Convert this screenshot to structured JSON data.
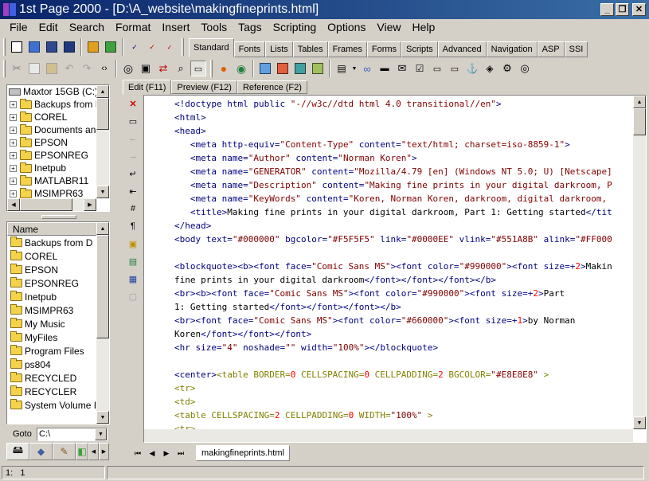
{
  "window": {
    "title": "1st Page 2000 - [D:\\A_website\\makingfineprints.html]",
    "controls": {
      "minimize": "_",
      "restore": "❐",
      "close": "✕"
    }
  },
  "menu": [
    "File",
    "Edit",
    "Search",
    "Format",
    "Insert",
    "Tools",
    "Tags",
    "Scripting",
    "Options",
    "View",
    "Help"
  ],
  "tag_tabs": [
    "Standard",
    "Fonts",
    "Lists",
    "Tables",
    "Frames",
    "Forms",
    "Scripts",
    "Advanced",
    "Navigation",
    "ASP",
    "SSI"
  ],
  "active_tag_tab": "Standard",
  "toolbar_icons": [
    "new-file-icon",
    "open-icon",
    "save-icon",
    "save-all-icon",
    "preview-icon",
    "publish-icon",
    "spell-check-icon",
    "spell-check-2-icon",
    "spell-abc-icon"
  ],
  "drives": {
    "header": "Maxtor 15GB (C:)",
    "folders": [
      "Backups from D",
      "COREL",
      "Documents and",
      "EPSON",
      "EPSONREG",
      "Inetpub",
      "MATLABR11",
      "MSIMPR63"
    ]
  },
  "files": {
    "column": "Name",
    "items": [
      "Backups from D",
      "COREL",
      "EPSON",
      "EPSONREG",
      "Inetpub",
      "MSIMPR63",
      "My Music",
      "MyFiles",
      "Program Files",
      "ps804",
      "RECYCLED",
      "RECYCLER",
      "System Volume Info"
    ]
  },
  "goto": {
    "label": "Goto",
    "value": "C:\\"
  },
  "editor_tabs": [
    "Edit (F11)",
    "Preview (F12)",
    "Reference (F2)"
  ],
  "active_editor_tab": "Edit (F11)",
  "document_tab": "makingfineprints.html",
  "status": {
    "position": "1:   1"
  },
  "colors": {
    "tag": "#000080",
    "value": "#800000",
    "other_tag": "#808000",
    "number": "#ff0000",
    "titlebar_start": "#0a246a",
    "titlebar_end": "#3a6ea5"
  },
  "code": [
    [
      [
        "t",
        "<!doctype html public "
      ],
      [
        "v",
        "\"-//w3c//dtd html 4.0 transitional//en\""
      ],
      [
        "t",
        ">"
      ]
    ],
    [
      [
        "t",
        "<html>"
      ]
    ],
    [
      [
        "t",
        "<head>"
      ]
    ],
    [
      [
        "p",
        "   "
      ],
      [
        "t",
        "<meta http-equiv="
      ],
      [
        "v",
        "\"Content-Type\""
      ],
      [
        "t",
        " content="
      ],
      [
        "v",
        "\"text/html; charset=iso-8859-1\""
      ],
      [
        "t",
        ">"
      ]
    ],
    [
      [
        "p",
        "   "
      ],
      [
        "t",
        "<meta name="
      ],
      [
        "v",
        "\"Author\""
      ],
      [
        "t",
        " content="
      ],
      [
        "v",
        "\"Norman Koren\""
      ],
      [
        "t",
        ">"
      ]
    ],
    [
      [
        "p",
        "   "
      ],
      [
        "t",
        "<meta name="
      ],
      [
        "v",
        "\"GENERATOR\""
      ],
      [
        "t",
        " content="
      ],
      [
        "v",
        "\"Mozilla/4.79 [en] (Windows NT 5.0; U) [Netscape]"
      ]
    ],
    [
      [
        "p",
        "   "
      ],
      [
        "t",
        "<meta name="
      ],
      [
        "v",
        "\"Description\""
      ],
      [
        "t",
        " content="
      ],
      [
        "v",
        "\"Making fine prints in your digital darkroom, P"
      ]
    ],
    [
      [
        "p",
        "   "
      ],
      [
        "t",
        "<meta name="
      ],
      [
        "v",
        "\"KeyWords\""
      ],
      [
        "t",
        " content="
      ],
      [
        "v",
        "\"Koren, Norman Koren, darkroom, digital darkroom,"
      ]
    ],
    [
      [
        "p",
        "   "
      ],
      [
        "t",
        "<title>"
      ],
      [
        "p",
        "Making fine prints in your digital darkroom, Part 1: Getting started"
      ],
      [
        "t",
        "</tit"
      ]
    ],
    [
      [
        "t",
        "</head>"
      ]
    ],
    [
      [
        "t",
        "<body text="
      ],
      [
        "v",
        "\"#000000\""
      ],
      [
        "t",
        " bgcolor="
      ],
      [
        "v",
        "\"#F5F5F5\""
      ],
      [
        "t",
        " link="
      ],
      [
        "v",
        "\"#0000EE\""
      ],
      [
        "t",
        " vlink="
      ],
      [
        "v",
        "\"#551A8B\""
      ],
      [
        "t",
        " alink="
      ],
      [
        "v",
        "\"#FF000"
      ]
    ],
    [
      [
        "p",
        ""
      ]
    ],
    [
      [
        "t",
        "<blockquote><b><font face="
      ],
      [
        "v",
        "\"Comic Sans MS\""
      ],
      [
        "t",
        "><font color="
      ],
      [
        "v",
        "\"#990000\""
      ],
      [
        "t",
        "><font size=+"
      ],
      [
        "n",
        "2"
      ],
      [
        "t",
        ">"
      ],
      [
        "p",
        "Makin"
      ]
    ],
    [
      [
        "p",
        "fine prints in your digital darkroom"
      ],
      [
        "t",
        "</font></font></font></b>"
      ]
    ],
    [
      [
        "t",
        "<br><b><font face="
      ],
      [
        "v",
        "\"Comic Sans MS\""
      ],
      [
        "t",
        "><font color="
      ],
      [
        "v",
        "\"#990000\""
      ],
      [
        "t",
        "><font size=+"
      ],
      [
        "n",
        "2"
      ],
      [
        "t",
        ">"
      ],
      [
        "p",
        "Part"
      ]
    ],
    [
      [
        "p",
        "1: Getting started"
      ],
      [
        "t",
        "</font></font></font></b>"
      ]
    ],
    [
      [
        "t",
        "<br><font face="
      ],
      [
        "v",
        "\"Comic Sans MS\""
      ],
      [
        "t",
        "><font color="
      ],
      [
        "v",
        "\"#660000\""
      ],
      [
        "t",
        "><font size=+"
      ],
      [
        "n",
        "1"
      ],
      [
        "t",
        ">"
      ],
      [
        "p",
        "by Norman"
      ]
    ],
    [
      [
        "p",
        "Koren"
      ],
      [
        "t",
        "</font></font></font>"
      ]
    ],
    [
      [
        "t",
        "<hr size="
      ],
      [
        "v",
        "\"4\""
      ],
      [
        "t",
        " noshade="
      ],
      [
        "v",
        "\"\""
      ],
      [
        "t",
        " width="
      ],
      [
        "v",
        "\"100%\""
      ],
      [
        "t",
        "></blockquote>"
      ]
    ],
    [
      [
        "p",
        ""
      ]
    ],
    [
      [
        "t",
        "<center>"
      ],
      [
        "o",
        "<table BORDER="
      ],
      [
        "n",
        "0"
      ],
      [
        "o",
        " CELLSPACING="
      ],
      [
        "n",
        "0"
      ],
      [
        "o",
        " CELLPADDING="
      ],
      [
        "n",
        "2"
      ],
      [
        "o",
        " BGCOLOR="
      ],
      [
        "v",
        "\"#E8E8E8\""
      ],
      [
        "o",
        " >"
      ]
    ],
    [
      [
        "o",
        "<tr>"
      ]
    ],
    [
      [
        "o",
        "<td>"
      ]
    ],
    [
      [
        "o",
        "<table CELLSPACING="
      ],
      [
        "n",
        "2"
      ],
      [
        "o",
        " CELLPADDING="
      ],
      [
        "n",
        "0"
      ],
      [
        "o",
        " WIDTH="
      ],
      [
        "v",
        "\"100%\""
      ],
      [
        "o",
        " >"
      ]
    ],
    [
      [
        "o",
        "<tr>"
      ]
    ]
  ]
}
